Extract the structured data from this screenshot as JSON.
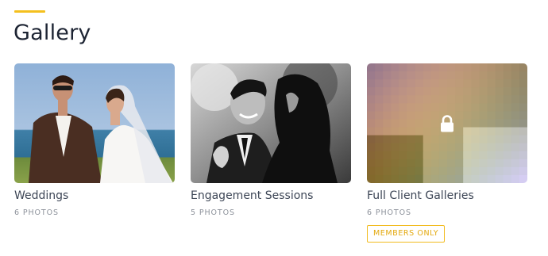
{
  "page": {
    "title": "Gallery",
    "accent_color": "#f4c01e"
  },
  "galleries": [
    {
      "title": "Weddings",
      "count": "6 PHOTOS"
    },
    {
      "title": "Engagement Sessions",
      "count": "5 PHOTOS"
    },
    {
      "title": "Full Client Galleries",
      "count": "6 PHOTOS",
      "badge": "MEMBERS ONLY",
      "locked_icon": "lock-icon"
    }
  ]
}
